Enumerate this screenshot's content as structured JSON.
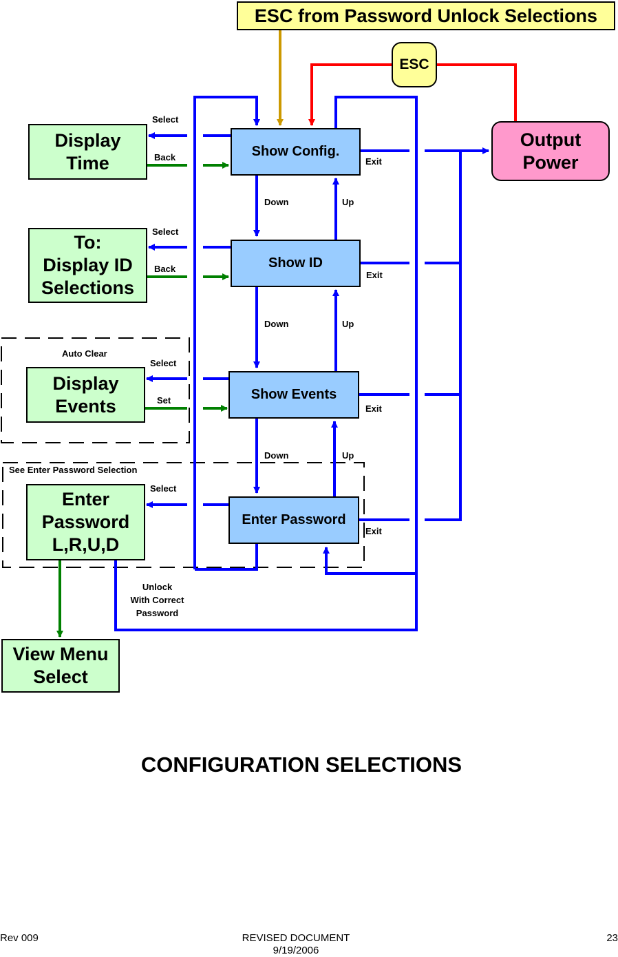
{
  "banner": {
    "title": "ESC from Password Unlock Selections"
  },
  "esc_node": {
    "label": "ESC"
  },
  "output_node": {
    "label": "Output\nPower"
  },
  "menu_nodes": {
    "show_config": "Show Config.",
    "show_id": "Show ID",
    "show_events": "Show Events",
    "enter_password": "Enter Password"
  },
  "target_nodes": {
    "display_time": "Display\nTime",
    "display_id": "To:\nDisplay ID\nSelections",
    "display_events": "Display\nEvents",
    "enter_password_lrud": "Enter\nPassword\nL,R,U,D",
    "view_menu_select": "View Menu\nSelect"
  },
  "edge_labels": {
    "select": "Select",
    "back": "Back",
    "set": "Set",
    "exit": "Exit",
    "down": "Down",
    "up": "Up",
    "auto_clear": "Auto Clear",
    "see_enter_password": "See Enter Password Selection",
    "unlock": "Unlock\nWith Correct\nPassword"
  },
  "colors": {
    "flow_blue": "#0000ff",
    "back_green": "#008000",
    "esc_red": "#ff0000",
    "banner_gold": "#cc9900",
    "target_fill": "#ccffcc",
    "menu_fill": "#99ccff",
    "output_fill": "#ff99cc",
    "banner_fill": "#ffff99"
  },
  "page": {
    "title": "CONFIGURATION SELECTIONS",
    "footer_left": "Rev 009",
    "footer_center": "REVISED DOCUMENT\n9/19/2006",
    "footer_right": "23"
  }
}
